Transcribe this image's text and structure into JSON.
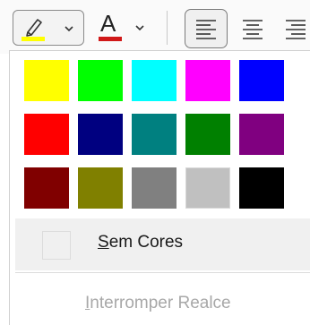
{
  "toolbar": {
    "highlight_color": "#ffff00",
    "font_color": "#d01818",
    "font_color_letter": "A"
  },
  "palette": {
    "swatches": [
      {
        "color": "#ffff00"
      },
      {
        "color": "#00ff00"
      },
      {
        "color": "#00ffff"
      },
      {
        "color": "#ff00ff"
      },
      {
        "color": "#0000ff"
      },
      {
        "color": "#ff0000"
      },
      {
        "color": "#000080"
      },
      {
        "color": "#008080"
      },
      {
        "color": "#008000"
      },
      {
        "color": "#800080"
      },
      {
        "color": "#800000"
      },
      {
        "color": "#808000"
      },
      {
        "color": "#808080"
      },
      {
        "color": "#c0c0c0"
      },
      {
        "color": "#000000"
      }
    ]
  },
  "menu": {
    "no_color_first": "S",
    "no_color_rest": "em Cores",
    "stop_first": "I",
    "stop_rest": "nterromper Realce"
  }
}
